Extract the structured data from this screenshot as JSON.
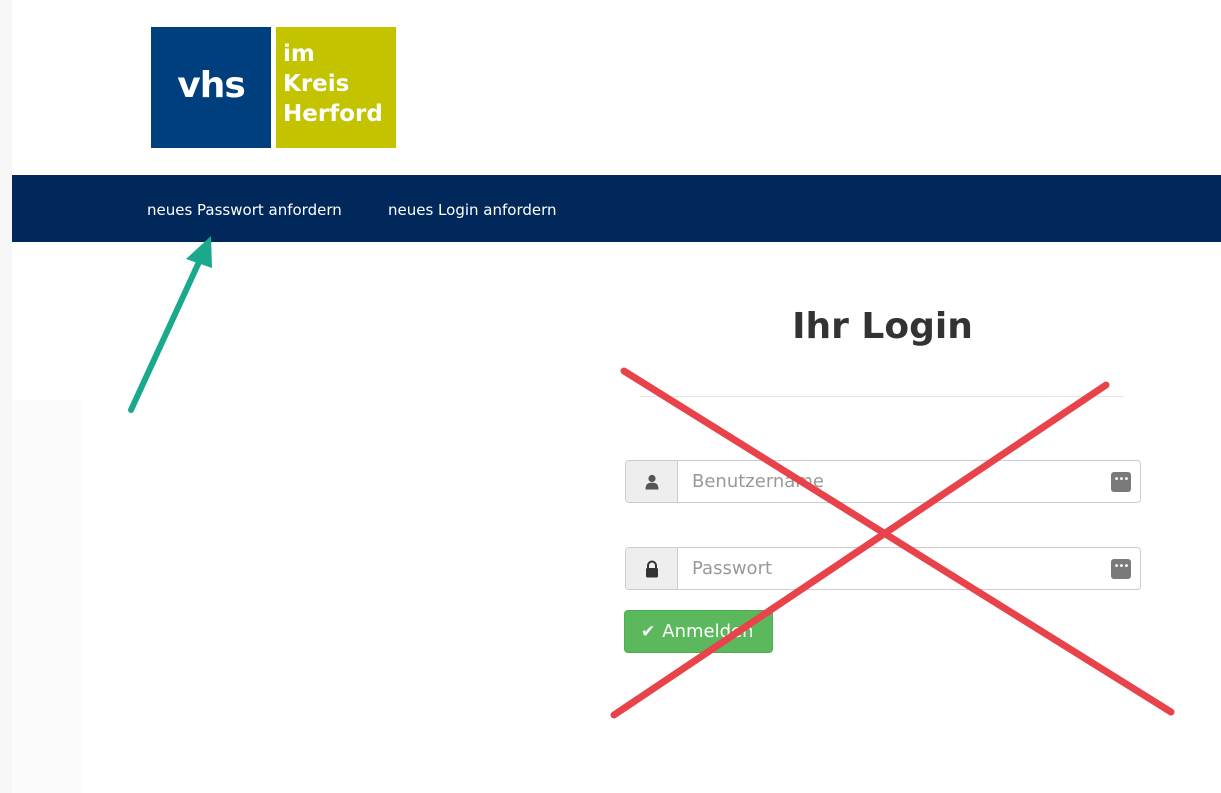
{
  "logo": {
    "left_text": "vhs",
    "right_lines": [
      "im",
      "Kreis",
      "Herford"
    ],
    "colors": {
      "left": "#003f7d",
      "right": "#c3c300"
    }
  },
  "nav": {
    "items": [
      {
        "label": "neues Passwort anfordern"
      },
      {
        "label": "neues Login anfordern"
      }
    ],
    "background": "#00285a"
  },
  "login": {
    "title": "Ihr Login",
    "username": {
      "value": "",
      "placeholder": "Benutzername",
      "icon": "user-icon"
    },
    "password": {
      "value": "",
      "placeholder": "Passwort",
      "icon": "lock-icon"
    },
    "submit_label": "Anmelden",
    "submit_color": "#5cb85c"
  },
  "annotations": {
    "arrow_color": "#1aa98a",
    "cross_color": "#e8424b"
  }
}
